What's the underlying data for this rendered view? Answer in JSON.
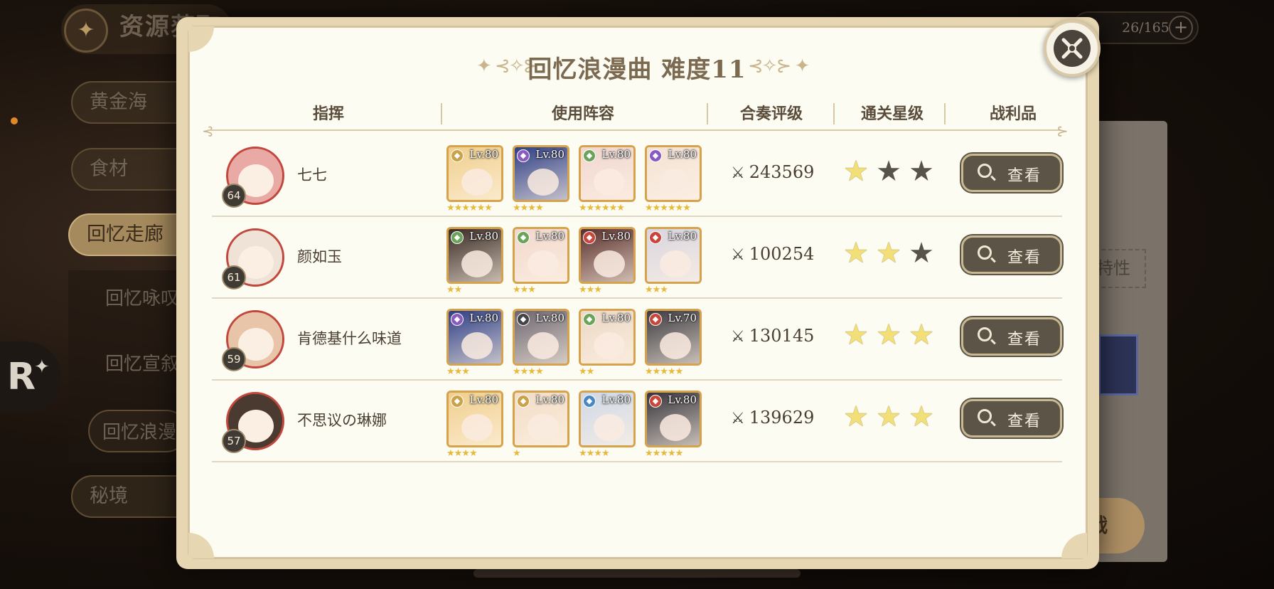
{
  "background": {
    "section_title": "资源获取",
    "counter": "26/165",
    "menu": [
      "黄金海",
      "食材",
      "回忆走廊",
      "秘境"
    ],
    "submenu": [
      "回忆咏叹",
      "回忆宣叙",
      "回忆浪漫"
    ],
    "right_partial_label": "特性",
    "right_partial_button": "战",
    "r_logo": "R"
  },
  "modal": {
    "title": "回忆浪漫曲 难度11",
    "columns": [
      "指挥",
      "使用阵容",
      "合奏评级",
      "通关星级",
      "战利品"
    ],
    "view_label": "查看",
    "rows": [
      {
        "name": "七七",
        "level": "64",
        "avatar_color": "#e9a9a4",
        "score": "243569",
        "stars": 1,
        "team": [
          {
            "lv": "Lv.80",
            "stars": 6,
            "color": "#f0cf8c",
            "elem": "#c9a24a"
          },
          {
            "lv": "Lv.80",
            "stars": 4,
            "color": "#2f3f86",
            "elem": "#8a5bbf"
          },
          {
            "lv": "Lv.80",
            "stars": 6,
            "color": "#f0d6d0",
            "elem": "#6aa35a"
          },
          {
            "lv": "Lv.80",
            "stars": 6,
            "color": "#f3e2d4",
            "elem": "#8a5bbf"
          }
        ]
      },
      {
        "name": "颜如玉",
        "level": "61",
        "avatar_color": "#efe3d7",
        "score": "100254",
        "stars": 2,
        "team": [
          {
            "lv": "Lv.80",
            "stars": 2,
            "color": "#3a2b24",
            "elem": "#6aa35a"
          },
          {
            "lv": "Lv.80",
            "stars": 3,
            "color": "#f1d8cc",
            "elem": "#6aa35a"
          },
          {
            "lv": "Lv.80",
            "stars": 3,
            "color": "#5a2f2c",
            "elem": "#c9463a"
          },
          {
            "lv": "Lv.80",
            "stars": 3,
            "color": "#d9d5df",
            "elem": "#c9463a"
          }
        ]
      },
      {
        "name": "肯德基什么味道",
        "level": "59",
        "avatar_color": "#e8c4a8",
        "score": "130145",
        "stars": 3,
        "team": [
          {
            "lv": "Lv.80",
            "stars": 3,
            "color": "#2f3f86",
            "elem": "#8a5bbf"
          },
          {
            "lv": "Lv.80",
            "stars": 4,
            "color": "#6d6670",
            "elem": "#444"
          },
          {
            "lv": "Lv.80",
            "stars": 2,
            "color": "#ecd8c6",
            "elem": "#6aa35a"
          },
          {
            "lv": "Lv.70",
            "stars": 5,
            "color": "#3d3a40",
            "elem": "#c9463a"
          }
        ]
      },
      {
        "name": "不思议の琳娜",
        "level": "57",
        "avatar_color": "#4a3a30",
        "score": "139629",
        "stars": 3,
        "team": [
          {
            "lv": "Lv.80",
            "stars": 4,
            "color": "#f0cf8c",
            "elem": "#c9a24a"
          },
          {
            "lv": "Lv.80",
            "stars": 1,
            "color": "#f2dcc6",
            "elem": "#c9a24a"
          },
          {
            "lv": "Lv.80",
            "stars": 4,
            "color": "#cfd8e6",
            "elem": "#4a86c2"
          },
          {
            "lv": "Lv.80",
            "stars": 5,
            "color": "#36333a",
            "elem": "#c9463a"
          }
        ]
      }
    ]
  }
}
